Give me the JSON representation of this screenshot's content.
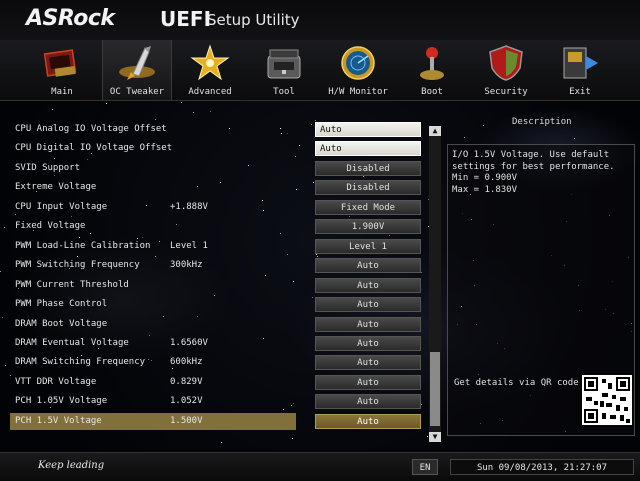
{
  "header": {
    "logo": "ASRock",
    "brand": "UEFI",
    "subtitle": "Setup Utility"
  },
  "tabs": [
    {
      "label": "Main",
      "icon": "main-icon"
    },
    {
      "label": "OC Tweaker",
      "icon": "rocket-icon",
      "active": true
    },
    {
      "label": "Advanced",
      "icon": "star-burst-icon"
    },
    {
      "label": "Tool",
      "icon": "toolbox-icon"
    },
    {
      "label": "H/W Monitor",
      "icon": "radar-icon"
    },
    {
      "label": "Boot",
      "icon": "joystick-icon"
    },
    {
      "label": "Security",
      "icon": "shield-icon"
    },
    {
      "label": "Exit",
      "icon": "exit-door-icon"
    }
  ],
  "settings": [
    {
      "name": "CPU Analog IO Voltage Offset",
      "current": "",
      "control": "Auto"
    },
    {
      "name": "CPU Digital IO Voltage Offset",
      "current": "",
      "control": "Auto"
    },
    {
      "name": "SVID Support",
      "current": "",
      "control": "Disabled"
    },
    {
      "name": "Extreme Voltage",
      "current": "",
      "control": "Disabled"
    },
    {
      "name": "CPU Input Voltage",
      "current": "+1.888V",
      "control": "Fixed Mode"
    },
    {
      "name": "Fixed Voltage",
      "current": "",
      "control": "1.900V"
    },
    {
      "name": "PWM Load-Line Calibration",
      "current": "Level 1",
      "control": "Level 1"
    },
    {
      "name": "PWM Switching Frequency",
      "current": "300kHz",
      "control": "Auto"
    },
    {
      "name": "PWM Current Threshold",
      "current": "",
      "control": "Auto"
    },
    {
      "name": "PWM Phase Control",
      "current": "",
      "control": "Auto"
    },
    {
      "name": "DRAM Boot Voltage",
      "current": "",
      "control": "Auto"
    },
    {
      "name": "DRAM Eventual Voltage",
      "current": "1.6560V",
      "control": "Auto"
    },
    {
      "name": "DRAM Switching Frequency",
      "current": "600kHz",
      "control": "Auto"
    },
    {
      "name": "VTT DDR Voltage",
      "current": "0.829V",
      "control": "Auto"
    },
    {
      "name": "PCH 1.05V Voltage",
      "current": "1.052V",
      "control": "Auto"
    },
    {
      "name": "PCH 1.5V Voltage",
      "current": "1.500V",
      "control": "Auto",
      "selected": true
    }
  ],
  "description": {
    "title": "Description",
    "text": "I/O 1.5V Voltage. Use default\nsettings for best performance.\nMin = 0.900V\nMax = 1.830V",
    "qr_label": "Get details via QR code"
  },
  "scrollbar": {
    "up": "▲",
    "down": "▼"
  },
  "footer": {
    "slogan": "Keep leading",
    "language": "EN",
    "datetime": "Sun 09/08/2013, 21:27:07"
  },
  "colors": {
    "selected_row": "#82703a",
    "active_control": "#f4f4f0"
  }
}
